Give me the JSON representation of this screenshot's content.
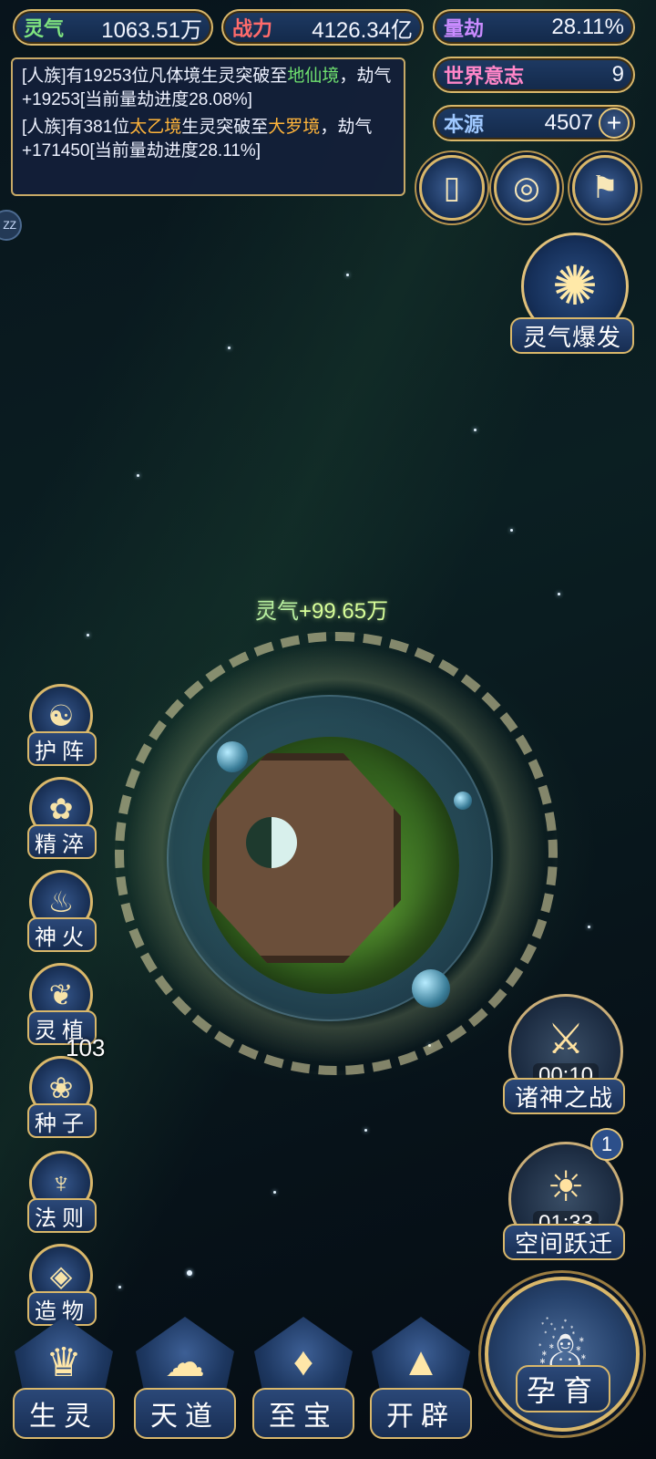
{
  "stats": {
    "lingqi": {
      "label": "灵气",
      "value": "1063.51万"
    },
    "zhanli": {
      "label": "战力",
      "value": "4126.34亿"
    },
    "liangjie": {
      "label": "量劫",
      "value": "28.11%"
    },
    "shijie": {
      "label": "世界意志",
      "value": "9"
    },
    "benyuan": {
      "label": "本源",
      "value": "4507",
      "plus": "+"
    }
  },
  "log": {
    "m1_a": "[人族]有19253位凡体境生灵突破至",
    "m1_realm": "地仙境",
    "m1_b": "，劫气+19253[当前量劫进度28.08%]",
    "m2_a": "[人族]有381位",
    "m2_realm1": "太乙境",
    "m2_b": "生灵突破至",
    "m2_realm2": "大罗境",
    "m2_c": "，劫气+171450[当前量劫进度28.11%]"
  },
  "side_badge": "ZZ",
  "burst": {
    "label": "灵气爆发"
  },
  "gain": {
    "label": "灵气",
    "value": "+99.65万"
  },
  "left_menu": [
    {
      "label": "护阵",
      "icon": "taiji-icon"
    },
    {
      "label": "精淬",
      "icon": "lotus-icon"
    },
    {
      "label": "神火",
      "icon": "flame-icon"
    },
    {
      "label": "灵植",
      "icon": "plant-icon"
    },
    {
      "label": "种子",
      "icon": "seed-icon"
    },
    {
      "label": "法则",
      "icon": "law-icon"
    },
    {
      "label": "造物",
      "icon": "creation-icon"
    }
  ],
  "seed_count": "103",
  "gods_war": {
    "timer": "00:10",
    "label": "诸神之战"
  },
  "space_jump": {
    "timer": "01:33",
    "label": "空间跃迁",
    "badge": "1"
  },
  "bottom_nav": [
    {
      "label": "生灵"
    },
    {
      "label": "天道"
    },
    {
      "label": "至宝"
    },
    {
      "label": "开辟"
    }
  ],
  "yunyu": {
    "label": "孕育"
  }
}
